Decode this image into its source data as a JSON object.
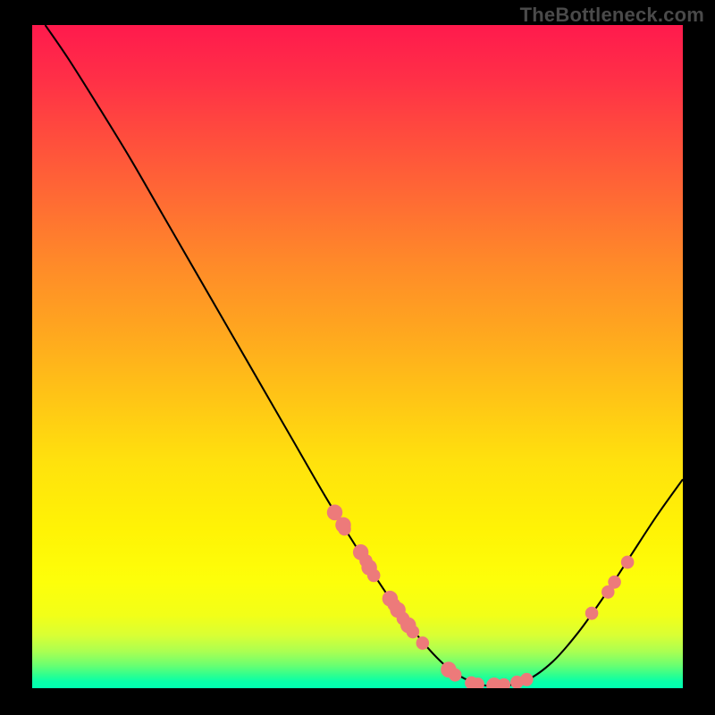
{
  "watermark": "TheBottleneck.com",
  "chart_data": {
    "type": "line",
    "title": "",
    "xlabel": "",
    "ylabel": "",
    "xlim": [
      0,
      100
    ],
    "ylim": [
      0,
      100
    ],
    "grid": false,
    "legend": false,
    "curve": [
      {
        "x": 2.0,
        "y": 100.0
      },
      {
        "x": 5.5,
        "y": 95.0
      },
      {
        "x": 10.0,
        "y": 88.0
      },
      {
        "x": 15.0,
        "y": 80.0
      },
      {
        "x": 20.0,
        "y": 71.5
      },
      {
        "x": 25.0,
        "y": 63.0
      },
      {
        "x": 30.0,
        "y": 54.5
      },
      {
        "x": 35.0,
        "y": 46.0
      },
      {
        "x": 40.0,
        "y": 37.5
      },
      {
        "x": 45.0,
        "y": 29.0
      },
      {
        "x": 50.0,
        "y": 21.0
      },
      {
        "x": 55.0,
        "y": 13.5
      },
      {
        "x": 60.0,
        "y": 7.0
      },
      {
        "x": 64.0,
        "y": 3.0
      },
      {
        "x": 68.0,
        "y": 0.8
      },
      {
        "x": 72.0,
        "y": 0.3
      },
      {
        "x": 76.0,
        "y": 1.2
      },
      {
        "x": 80.0,
        "y": 4.0
      },
      {
        "x": 84.0,
        "y": 8.5
      },
      {
        "x": 88.0,
        "y": 14.0
      },
      {
        "x": 92.0,
        "y": 20.0
      },
      {
        "x": 96.0,
        "y": 26.0
      },
      {
        "x": 100.0,
        "y": 31.5
      }
    ],
    "markers": [
      {
        "x": 46.5,
        "y": 26.5,
        "r": 1.2
      },
      {
        "x": 47.8,
        "y": 24.6,
        "r": 1.2
      },
      {
        "x": 48.0,
        "y": 24.0,
        "r": 1.0
      },
      {
        "x": 50.5,
        "y": 20.5,
        "r": 1.2
      },
      {
        "x": 51.3,
        "y": 19.2,
        "r": 1.0
      },
      {
        "x": 51.8,
        "y": 18.2,
        "r": 1.2
      },
      {
        "x": 52.5,
        "y": 17.0,
        "r": 1.0
      },
      {
        "x": 55.0,
        "y": 13.5,
        "r": 1.2
      },
      {
        "x": 55.6,
        "y": 12.6,
        "r": 1.0
      },
      {
        "x": 56.2,
        "y": 11.8,
        "r": 1.2
      },
      {
        "x": 57.0,
        "y": 10.5,
        "r": 1.0
      },
      {
        "x": 57.8,
        "y": 9.5,
        "r": 1.2
      },
      {
        "x": 58.5,
        "y": 8.5,
        "r": 1.0
      },
      {
        "x": 60.0,
        "y": 6.8,
        "r": 1.0
      },
      {
        "x": 64.0,
        "y": 2.8,
        "r": 1.2
      },
      {
        "x": 65.0,
        "y": 2.0,
        "r": 1.0
      },
      {
        "x": 67.5,
        "y": 0.8,
        "r": 1.0
      },
      {
        "x": 68.5,
        "y": 0.6,
        "r": 1.0
      },
      {
        "x": 71.0,
        "y": 0.4,
        "r": 1.2
      },
      {
        "x": 72.5,
        "y": 0.5,
        "r": 1.0
      },
      {
        "x": 74.5,
        "y": 0.9,
        "r": 1.0
      },
      {
        "x": 76.0,
        "y": 1.3,
        "r": 1.0
      },
      {
        "x": 86.0,
        "y": 11.3,
        "r": 1.0
      },
      {
        "x": 88.5,
        "y": 14.5,
        "r": 1.0
      },
      {
        "x": 89.5,
        "y": 16.0,
        "r": 1.0
      },
      {
        "x": 91.5,
        "y": 19.0,
        "r": 1.0
      }
    ],
    "marker_color": "#ed7a7a",
    "curve_color": "#000000"
  }
}
